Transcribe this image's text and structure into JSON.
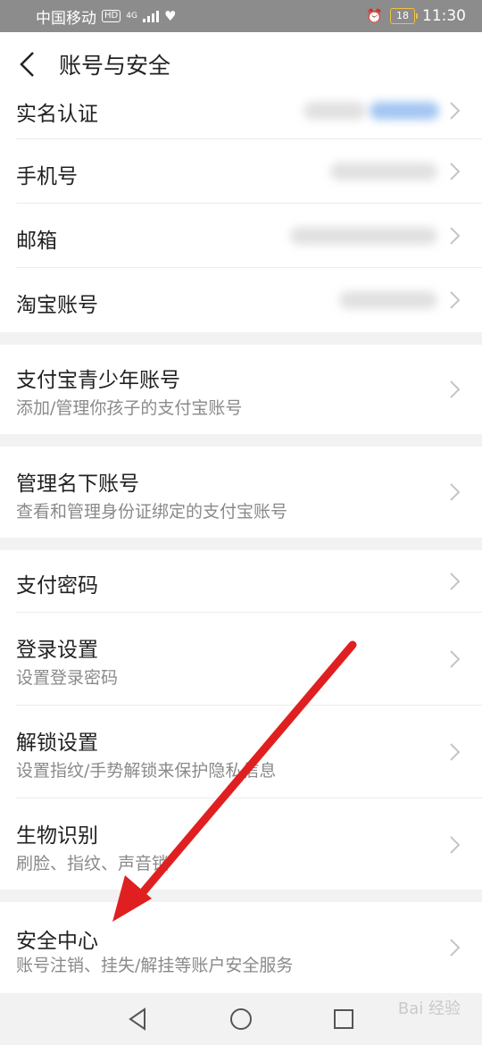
{
  "status_bar": {
    "carrier": "中国移动",
    "hd": "HD",
    "network": "4G",
    "battery": "18",
    "time": "11:30"
  },
  "header": {
    "title": "账号与安全"
  },
  "groups": {
    "account": [
      {
        "title": "实名认证"
      },
      {
        "title": "手机号"
      },
      {
        "title": "邮箱"
      },
      {
        "title": "淘宝账号"
      }
    ],
    "teen": {
      "title": "支付宝青少年账号",
      "subtitle": "添加/管理你孩子的支付宝账号"
    },
    "manage": {
      "title": "管理名下账号",
      "subtitle": "查看和管理身份证绑定的支付宝账号"
    },
    "security": [
      {
        "title": "支付密码",
        "subtitle": ""
      },
      {
        "title": "登录设置",
        "subtitle": "设置登录密码"
      },
      {
        "title": "解锁设置",
        "subtitle": "设置指纹/手势解锁来保护隐私信息"
      },
      {
        "title": "生物识别",
        "subtitle": "刷脸、指纹、声音锁"
      }
    ],
    "center": {
      "title": "安全中心",
      "subtitle": "账号注销、挂失/解挂等账户安全服务"
    }
  },
  "watermark": "Bai 经验",
  "colors": {
    "annotation_arrow": "#e02020",
    "status_bar_bg": "#8c8c8c",
    "battery_outline": "#f0c040"
  }
}
